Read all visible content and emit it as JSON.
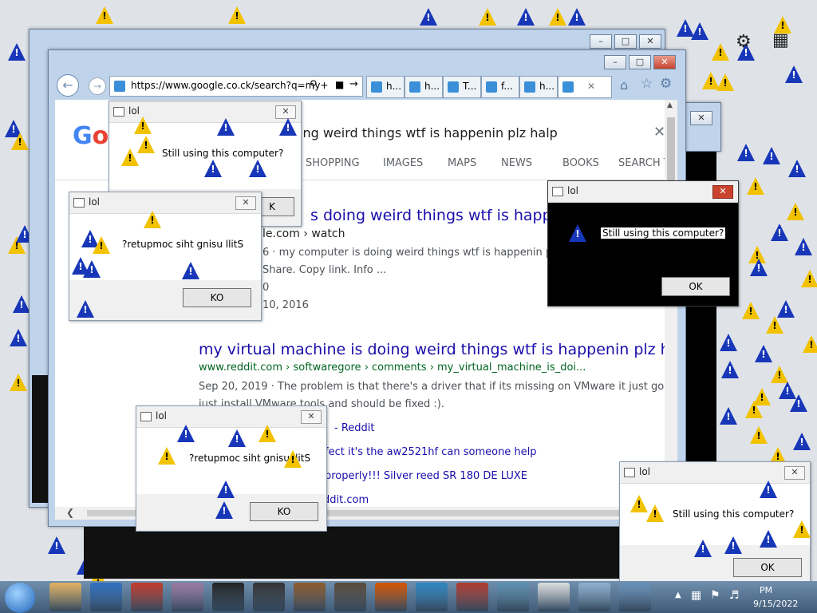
{
  "desktop": {
    "top_right_icons": [
      "gear-icon",
      "app-grid-icon"
    ]
  },
  "browser": {
    "url": "https://www.google.co.ck/search?q=my+",
    "tabs": [
      "h...",
      "h...",
      "T...",
      "f...",
      "h..."
    ],
    "search_query": "ing weird things wtf is happenin plz halp",
    "nav_tabs": [
      "SHOPPING",
      "IMAGES",
      "MAPS",
      "NEWS",
      "BOOKS",
      "SEARCH T"
    ],
    "results": [
      {
        "title": "s doing weird things wtf is happenin",
        "url": "le.com › watch",
        "snippet1": "6 · my computer is doing weird things wtf is happenin plz h",
        "snippet2": "Share. Copy link. Info ...",
        "meta1": "0",
        "meta2": "10, 2016"
      },
      {
        "title": "my virtual machine is doing weird things wtf is happenin plz halp",
        "url": "www.reddit.com › softwaregore › comments › my_virtual_machine_is_doi...",
        "snippet1": "Sep 20, 2019 · The problem is that there's a driver that if its missing on VMware it just goes cra",
        "snippet2": "just install VMware tools and should be fixed :)."
      }
    ],
    "related": [
      "- Reddit",
      "fect it's the aw2521hf can someone help",
      "properly!!! Silver reed SR 180 DE LUXE",
      "ddit.com"
    ]
  },
  "dialogs": [
    {
      "title": "lol",
      "message": "Still using this computer?",
      "button": "K"
    },
    {
      "title": "lol",
      "message": "?retupmoc siht gnisu llitS",
      "button": "KO"
    },
    {
      "title": "lol",
      "message": "Still using this computer?",
      "button": "OK"
    },
    {
      "title": "lol",
      "message": "?retupmoc siht gnisu llitS",
      "button": "KO"
    },
    {
      "title": "lol",
      "message": "Still using this computer?",
      "button": "OK"
    }
  ],
  "taskbar": {
    "clock_time": "PM",
    "clock_date": "9/15/2022"
  },
  "colors": {
    "warning_blue": "#1736b8",
    "warning_yellow": "#f2c200",
    "dark_dialog": "#000000"
  }
}
